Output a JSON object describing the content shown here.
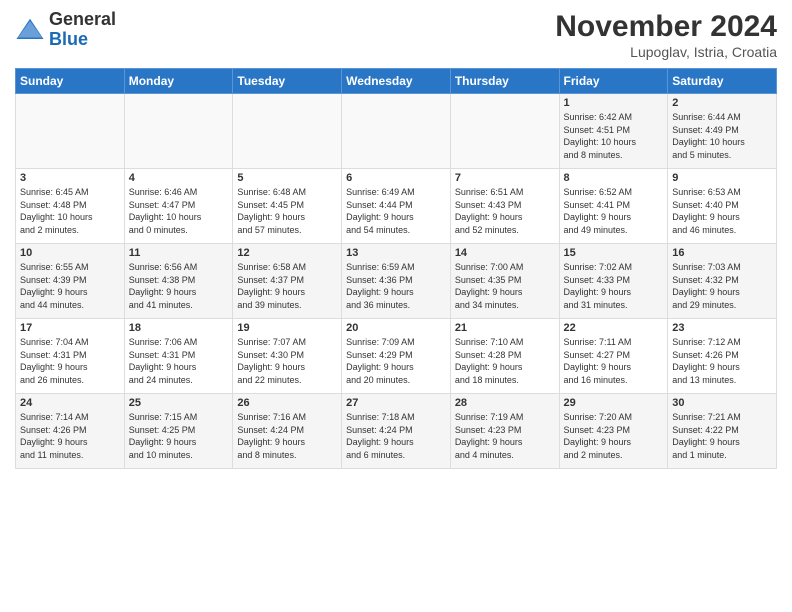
{
  "header": {
    "logo_general": "General",
    "logo_blue": "Blue",
    "title": "November 2024",
    "location": "Lupoglav, Istria, Croatia"
  },
  "weekdays": [
    "Sunday",
    "Monday",
    "Tuesday",
    "Wednesday",
    "Thursday",
    "Friday",
    "Saturday"
  ],
  "weeks": [
    [
      {
        "day": "",
        "info": ""
      },
      {
        "day": "",
        "info": ""
      },
      {
        "day": "",
        "info": ""
      },
      {
        "day": "",
        "info": ""
      },
      {
        "day": "",
        "info": ""
      },
      {
        "day": "1",
        "info": "Sunrise: 6:42 AM\nSunset: 4:51 PM\nDaylight: 10 hours\nand 8 minutes."
      },
      {
        "day": "2",
        "info": "Sunrise: 6:44 AM\nSunset: 4:49 PM\nDaylight: 10 hours\nand 5 minutes."
      }
    ],
    [
      {
        "day": "3",
        "info": "Sunrise: 6:45 AM\nSunset: 4:48 PM\nDaylight: 10 hours\nand 2 minutes."
      },
      {
        "day": "4",
        "info": "Sunrise: 6:46 AM\nSunset: 4:47 PM\nDaylight: 10 hours\nand 0 minutes."
      },
      {
        "day": "5",
        "info": "Sunrise: 6:48 AM\nSunset: 4:45 PM\nDaylight: 9 hours\nand 57 minutes."
      },
      {
        "day": "6",
        "info": "Sunrise: 6:49 AM\nSunset: 4:44 PM\nDaylight: 9 hours\nand 54 minutes."
      },
      {
        "day": "7",
        "info": "Sunrise: 6:51 AM\nSunset: 4:43 PM\nDaylight: 9 hours\nand 52 minutes."
      },
      {
        "day": "8",
        "info": "Sunrise: 6:52 AM\nSunset: 4:41 PM\nDaylight: 9 hours\nand 49 minutes."
      },
      {
        "day": "9",
        "info": "Sunrise: 6:53 AM\nSunset: 4:40 PM\nDaylight: 9 hours\nand 46 minutes."
      }
    ],
    [
      {
        "day": "10",
        "info": "Sunrise: 6:55 AM\nSunset: 4:39 PM\nDaylight: 9 hours\nand 44 minutes."
      },
      {
        "day": "11",
        "info": "Sunrise: 6:56 AM\nSunset: 4:38 PM\nDaylight: 9 hours\nand 41 minutes."
      },
      {
        "day": "12",
        "info": "Sunrise: 6:58 AM\nSunset: 4:37 PM\nDaylight: 9 hours\nand 39 minutes."
      },
      {
        "day": "13",
        "info": "Sunrise: 6:59 AM\nSunset: 4:36 PM\nDaylight: 9 hours\nand 36 minutes."
      },
      {
        "day": "14",
        "info": "Sunrise: 7:00 AM\nSunset: 4:35 PM\nDaylight: 9 hours\nand 34 minutes."
      },
      {
        "day": "15",
        "info": "Sunrise: 7:02 AM\nSunset: 4:33 PM\nDaylight: 9 hours\nand 31 minutes."
      },
      {
        "day": "16",
        "info": "Sunrise: 7:03 AM\nSunset: 4:32 PM\nDaylight: 9 hours\nand 29 minutes."
      }
    ],
    [
      {
        "day": "17",
        "info": "Sunrise: 7:04 AM\nSunset: 4:31 PM\nDaylight: 9 hours\nand 26 minutes."
      },
      {
        "day": "18",
        "info": "Sunrise: 7:06 AM\nSunset: 4:31 PM\nDaylight: 9 hours\nand 24 minutes."
      },
      {
        "day": "19",
        "info": "Sunrise: 7:07 AM\nSunset: 4:30 PM\nDaylight: 9 hours\nand 22 minutes."
      },
      {
        "day": "20",
        "info": "Sunrise: 7:09 AM\nSunset: 4:29 PM\nDaylight: 9 hours\nand 20 minutes."
      },
      {
        "day": "21",
        "info": "Sunrise: 7:10 AM\nSunset: 4:28 PM\nDaylight: 9 hours\nand 18 minutes."
      },
      {
        "day": "22",
        "info": "Sunrise: 7:11 AM\nSunset: 4:27 PM\nDaylight: 9 hours\nand 16 minutes."
      },
      {
        "day": "23",
        "info": "Sunrise: 7:12 AM\nSunset: 4:26 PM\nDaylight: 9 hours\nand 13 minutes."
      }
    ],
    [
      {
        "day": "24",
        "info": "Sunrise: 7:14 AM\nSunset: 4:26 PM\nDaylight: 9 hours\nand 11 minutes."
      },
      {
        "day": "25",
        "info": "Sunrise: 7:15 AM\nSunset: 4:25 PM\nDaylight: 9 hours\nand 10 minutes."
      },
      {
        "day": "26",
        "info": "Sunrise: 7:16 AM\nSunset: 4:24 PM\nDaylight: 9 hours\nand 8 minutes."
      },
      {
        "day": "27",
        "info": "Sunrise: 7:18 AM\nSunset: 4:24 PM\nDaylight: 9 hours\nand 6 minutes."
      },
      {
        "day": "28",
        "info": "Sunrise: 7:19 AM\nSunset: 4:23 PM\nDaylight: 9 hours\nand 4 minutes."
      },
      {
        "day": "29",
        "info": "Sunrise: 7:20 AM\nSunset: 4:23 PM\nDaylight: 9 hours\nand 2 minutes."
      },
      {
        "day": "30",
        "info": "Sunrise: 7:21 AM\nSunset: 4:22 PM\nDaylight: 9 hours\nand 1 minute."
      }
    ]
  ]
}
